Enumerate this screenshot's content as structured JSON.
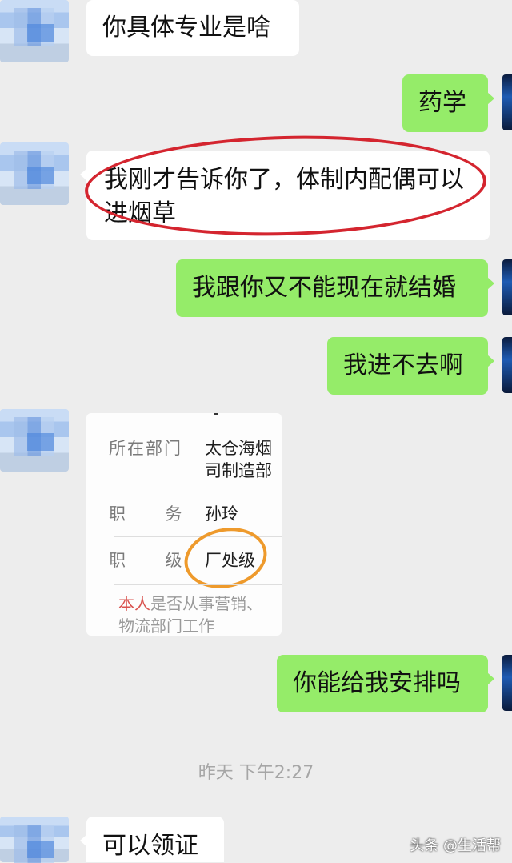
{
  "messages": {
    "m1": "你具体专业是啥",
    "m2": "药学",
    "m3_line1": "我刚才告诉你了，体制内配偶可以",
    "m3_line2": "进烟草",
    "m4": "我跟你又不能现在就结婚",
    "m5": "我进不去啊",
    "m7": "你能给我安排吗",
    "m8": "可以领证"
  },
  "image_card": {
    "dept_label": "所在部门",
    "dept_value_line1": "太仓海烟",
    "dept_value_line2": "司制造部",
    "role_label": "职  务",
    "role_value": "孙玲",
    "rank_label": "职  级",
    "rank_value": "厂处级",
    "note_red": "本人",
    "note_rest": "是否从事营销、",
    "note_line2": "物流部门工作"
  },
  "timestamp": "昨天 下午2:27",
  "watermark": "头条 @生活帮",
  "colors": {
    "chat_bg": "#ededed",
    "incoming_bubble": "#ffffff",
    "outgoing_bubble": "#95ec69",
    "highlight_red": "#d4252f",
    "highlight_orange": "#ee9a2c"
  }
}
